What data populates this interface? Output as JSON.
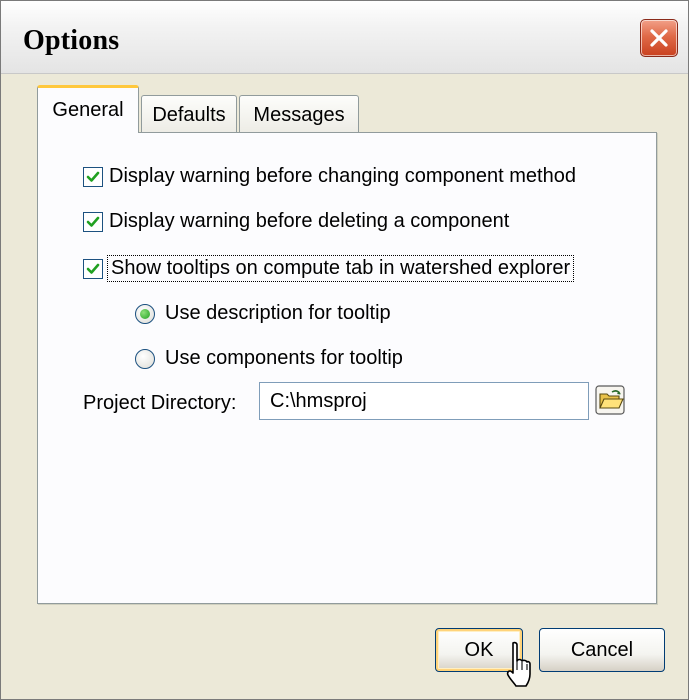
{
  "window": {
    "title": "Options",
    "close_icon": "close-icon"
  },
  "tabs": [
    {
      "label": "General",
      "active": true
    },
    {
      "label": "Defaults",
      "active": false
    },
    {
      "label": "Messages",
      "active": false
    }
  ],
  "general": {
    "checkboxes": [
      {
        "label": "Display warning before changing component method",
        "checked": true
      },
      {
        "label": "Display warning before deleting a component",
        "checked": true
      },
      {
        "label": "Show tooltips on compute tab in watershed explorer",
        "checked": true
      }
    ],
    "tooltip_options": [
      {
        "label": "Use description for tooltip",
        "selected": true
      },
      {
        "label": "Use components for tooltip",
        "selected": false
      }
    ],
    "project_directory": {
      "label": "Project Directory:",
      "value": "C:\\hmsproj",
      "browse_icon": "open-folder-icon"
    }
  },
  "buttons": {
    "ok": "OK",
    "cancel": "Cancel"
  },
  "colors": {
    "check": "#21a121",
    "active_tab_accent": "#ffc83c",
    "close_button": "#e06a48"
  }
}
